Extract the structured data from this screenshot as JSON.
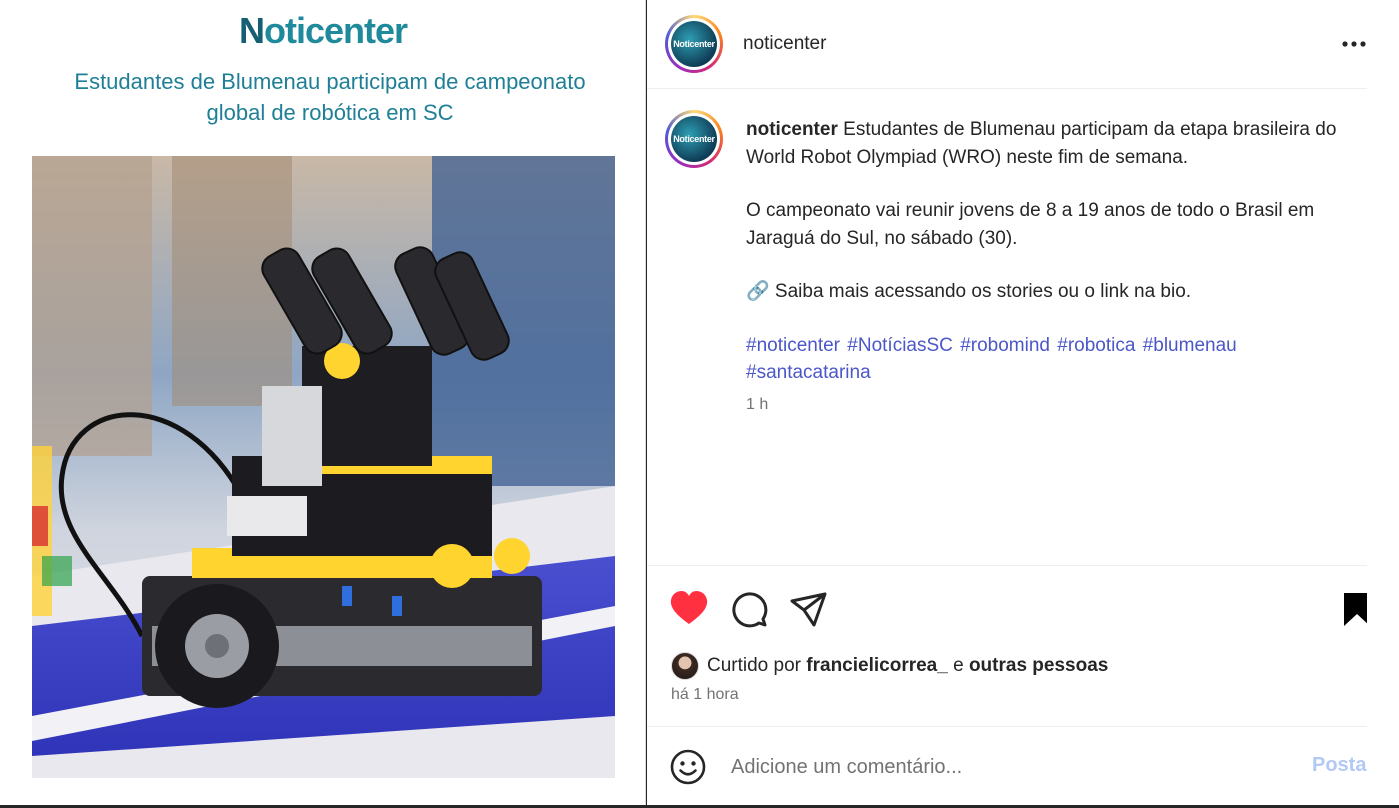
{
  "media": {
    "brand_logo_first": "N",
    "brand_logo_rest": "oticenter",
    "headline_line1": "Estudantes de Blumenau participam de campeonato",
    "headline_line2": "global de robótica em SC"
  },
  "header": {
    "avatar_text": "Noticenter",
    "username": "noticenter"
  },
  "caption": {
    "username": "noticenter",
    "paragraph1": "Estudantes de Blumenau participam da etapa brasileira do World Robot Olympiad (WRO) neste fim de semana.",
    "paragraph2": "O campeonato vai reunir jovens de 8 a 19 anos de todo o Brasil em Jaraguá do Sul, no sábado (30).",
    "paragraph3": "🔗 Saiba mais acessando os stories ou o link na bio.",
    "hashtags": [
      "#noticenter",
      "#NotíciasSC",
      "#robomind",
      "#robotica",
      "#blumenau",
      "#santacatarina"
    ],
    "time": "1 h"
  },
  "actions": {
    "liked": true,
    "like_color": "#ff3040",
    "icons": [
      "heart-icon",
      "comment-icon",
      "share-icon",
      "bookmark-icon"
    ]
  },
  "likes": {
    "prefix": "Curtido por",
    "user": "francielicorrea_",
    "connector": "e",
    "others": "outras pessoas",
    "time_ago": "há 1 hora"
  },
  "comment": {
    "placeholder": "Adicione um comentário...",
    "post_label": "Postar"
  },
  "colors": {
    "brand": "#1e8a9b",
    "hashtag": "#4b57c8",
    "post_button_disabled": "#b2c9f5"
  }
}
